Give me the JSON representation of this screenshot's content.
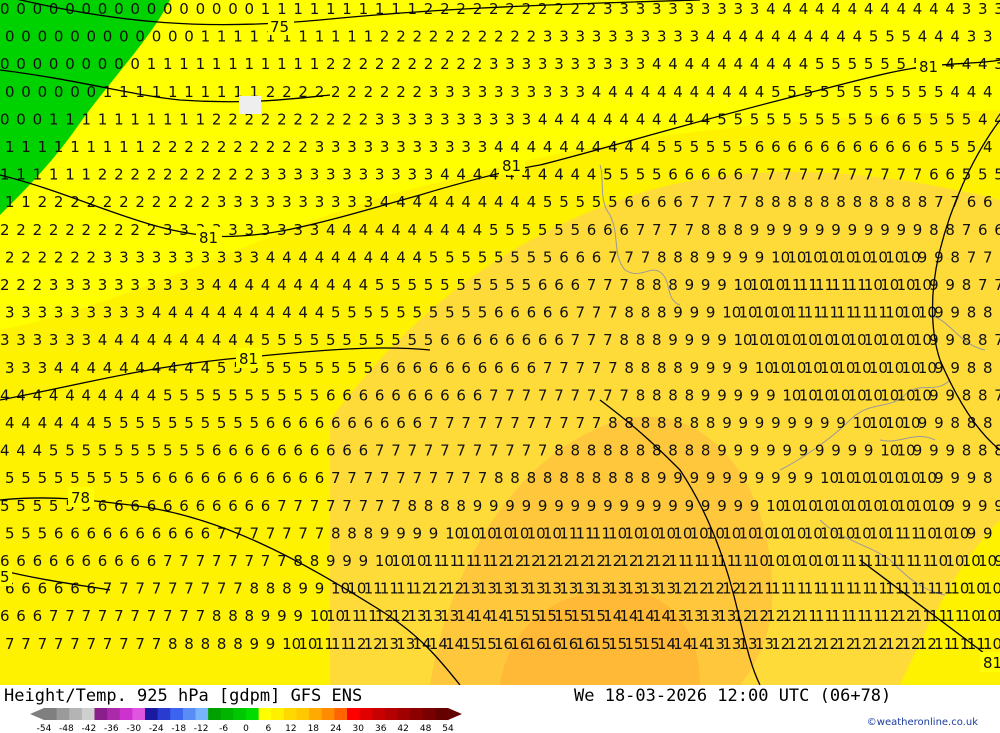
{
  "header": {
    "title": "Height/Temp. 925 hPa [gdpm] GFS ENS",
    "datetime": "We 18-03-2026 12:00 UTC (06+78)"
  },
  "credit": "©weatheronline.co.uk",
  "colorbar": {
    "ticks": [
      "-54",
      "-48",
      "-42",
      "-36",
      "-30",
      "-24",
      "-18",
      "-12",
      "-6",
      "0",
      "6",
      "12",
      "18",
      "24",
      "30",
      "36",
      "42",
      "48",
      "54"
    ],
    "colors": [
      "#7f7f7f",
      "#9a9a9a",
      "#b4b4b4",
      "#cfcfcf",
      "#8a1e8a",
      "#aa2aaa",
      "#cc33cc",
      "#e055e0",
      "#1a1aa0",
      "#2a3cd0",
      "#3c64f0",
      "#5a8cf5",
      "#78b4fa",
      "#00a000",
      "#00b400",
      "#00c800",
      "#00dc00",
      "#ffff00",
      "#fff000",
      "#ffd800",
      "#ffc800",
      "#ffaa00",
      "#ff8c00",
      "#ff6400",
      "#ff0000",
      "#e00000",
      "#c80000",
      "#b40000",
      "#a00000",
      "#8c0000",
      "#780000",
      "#640000"
    ]
  },
  "contour_labels": [
    "75",
    "81",
    "81",
    "81",
    "81",
    "78",
    "81",
    "5"
  ],
  "map": {
    "colors": {
      "green": "#00d200",
      "yellow": "#ffff00",
      "yellow_deep": "#fff200",
      "orange_light": "#ffdb3a",
      "orange": "#ffc83c"
    }
  }
}
